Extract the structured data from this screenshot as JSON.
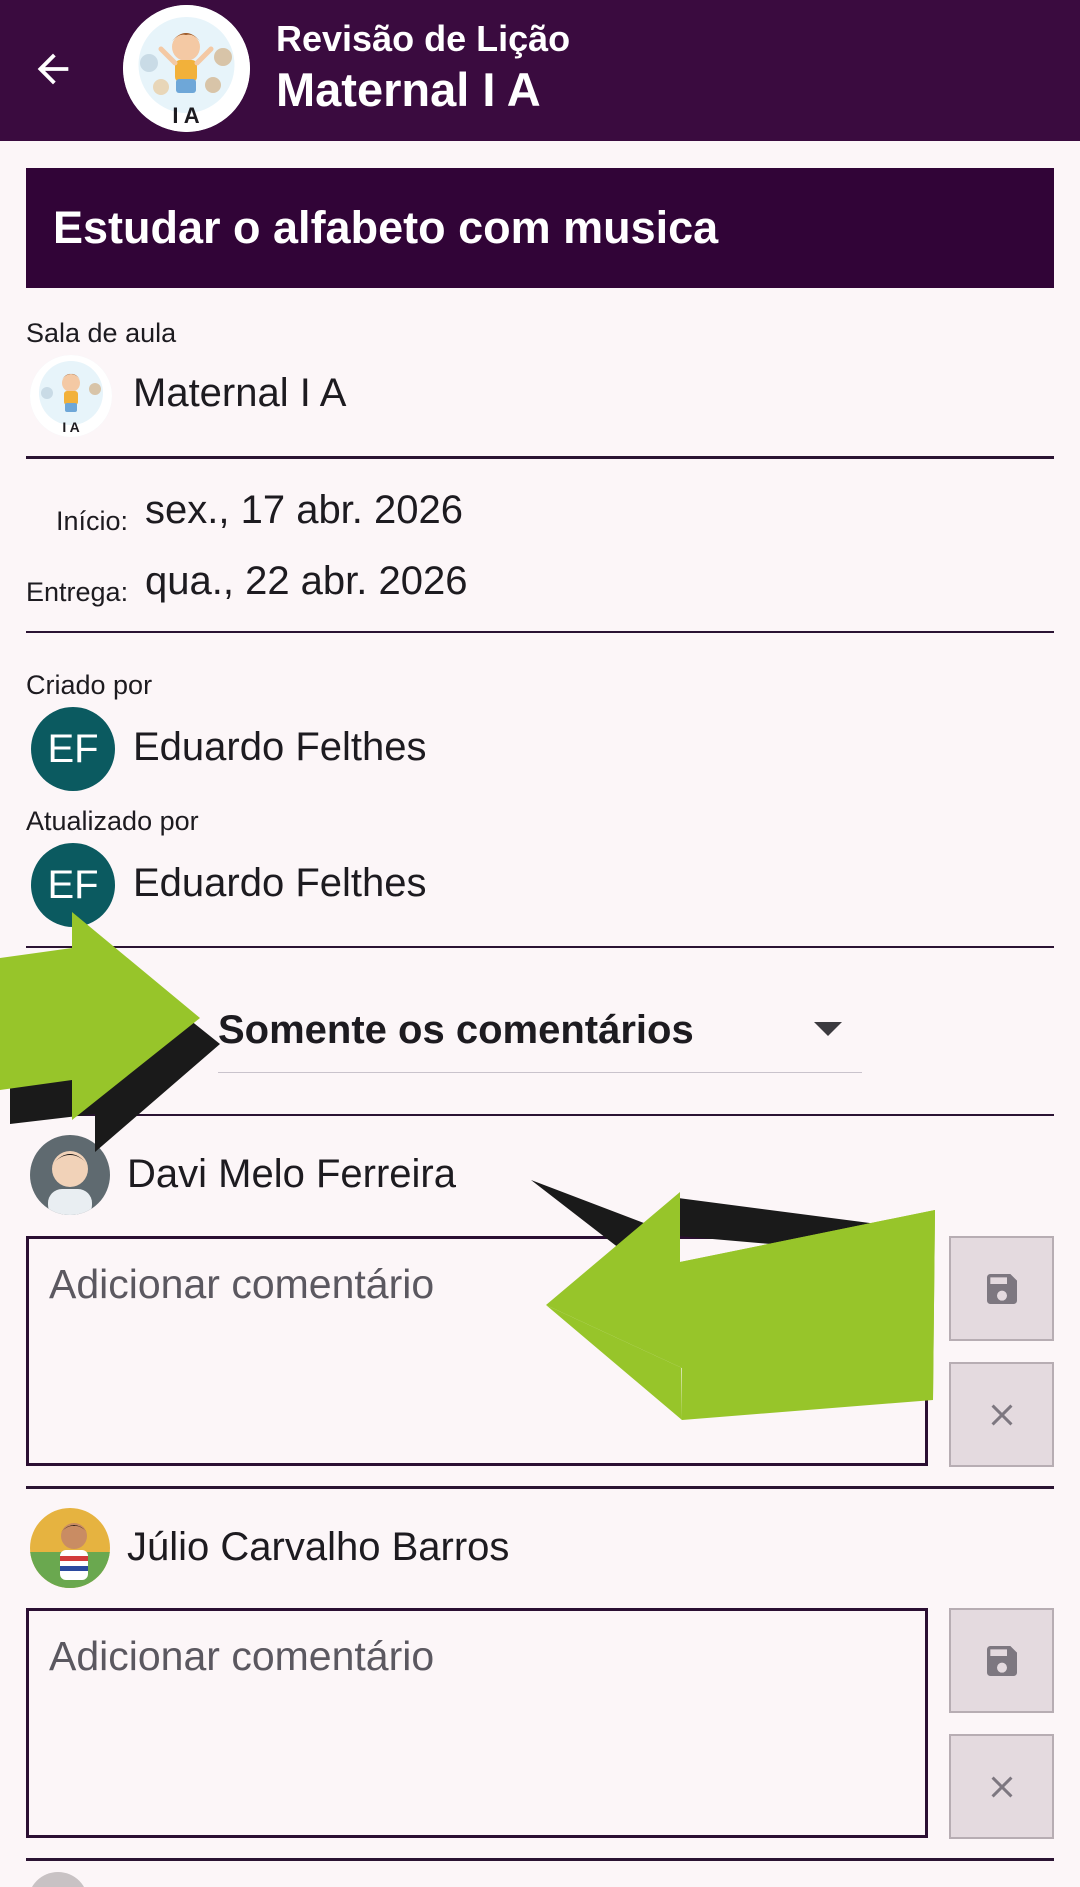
{
  "appbar": {
    "subtitle": "Revisão de Lição",
    "title": "Maternal I A",
    "avatar_text": "I A",
    "back_icon": "arrow-left-icon"
  },
  "lesson": {
    "title": "Estudar o alfabeto com musica"
  },
  "classroom": {
    "label": "Sala de aula",
    "name": "Maternal I A",
    "avatar_text": "I A"
  },
  "dates": {
    "start_label": "Início:",
    "start_value": "sex., 17 abr. 2026",
    "due_label": "Entrega:",
    "due_value": "qua., 22 abr. 2026"
  },
  "created_by": {
    "label": "Criado por",
    "initials": "EF",
    "name": "Eduardo Felthes"
  },
  "updated_by": {
    "label": "Atualizado por",
    "initials": "EF",
    "name": "Eduardo Felthes"
  },
  "filter": {
    "selected": "Somente os comentários"
  },
  "students": [
    {
      "name": "Davi Melo Ferreira",
      "comment_value": "",
      "comment_placeholder": "Adicionar comentário",
      "save_icon": "save-icon",
      "close_icon": "close-icon"
    },
    {
      "name": "Júlio Carvalho Barros",
      "comment_value": "",
      "comment_placeholder": "Adicionar comentário",
      "save_icon": "save-icon",
      "close_icon": "close-icon"
    }
  ],
  "colors": {
    "appbar": "#3a0b3f",
    "banner": "#310437",
    "avatar_teal": "#0b5a60",
    "annotation_arrow": "#97c52a",
    "background": "#fcf6f8"
  }
}
